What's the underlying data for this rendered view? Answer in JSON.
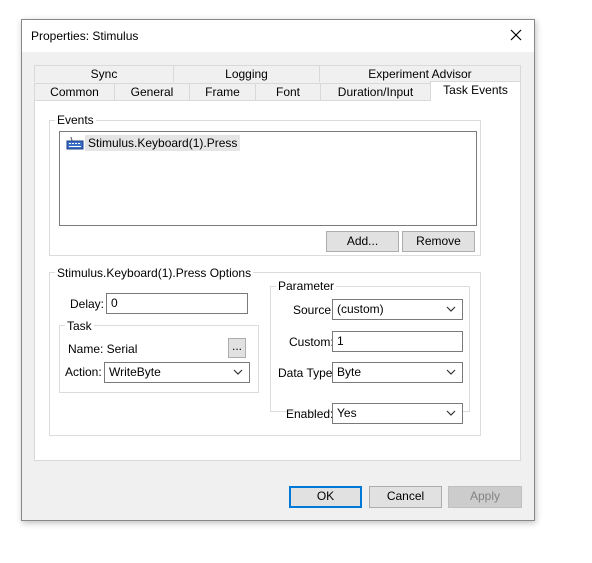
{
  "window": {
    "title": "Properties: Stimulus"
  },
  "tabs": {
    "row_top": [
      "Sync",
      "Logging",
      "Experiment Advisor"
    ],
    "row_bottom": [
      "Common",
      "General",
      "Frame",
      "Font",
      "Duration/Input",
      "Task Events"
    ],
    "active": "Task Events"
  },
  "events": {
    "group_label": "Events",
    "items": [
      "Stimulus.Keyboard(1).Press"
    ],
    "add_label": "Add...",
    "remove_label": "Remove"
  },
  "options": {
    "group_label": "Stimulus.Keyboard(1).Press Options",
    "delay_label": "Delay:",
    "delay_value": "0",
    "task": {
      "group_label": "Task",
      "name_text": "Name: Serial",
      "browse_label": "...",
      "action_label": "Action:",
      "action_value": "WriteByte"
    },
    "parameter": {
      "group_label": "Parameter",
      "source_label": "Source:",
      "source_value": "(custom)",
      "custom_label": "Custom:",
      "custom_value": "1",
      "datatype_label": "Data Type:",
      "datatype_value": "Byte"
    },
    "enabled_label": "Enabled:",
    "enabled_value": "Yes"
  },
  "footer": {
    "ok_label": "OK",
    "cancel_label": "Cancel",
    "apply_label": "Apply"
  }
}
